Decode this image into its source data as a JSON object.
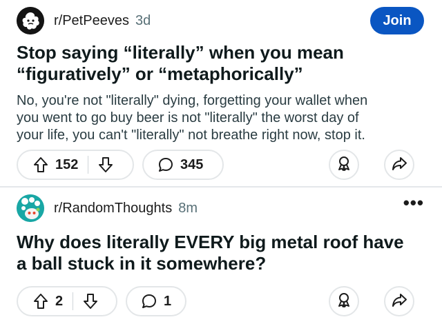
{
  "posts": [
    {
      "subreddit": "r/PetPeeves",
      "time": "3d",
      "join_label": "Join",
      "title_line1": "Stop saying “literally” when you mean",
      "title_line2": "“figuratively” or “metaphorically”",
      "body_line1": "No, you're not \"literally\" dying, forgetting your wallet when",
      "body_line2": "you went to go buy beer is not \"literally\" the worst day of",
      "body_line3": "your life, you can't \"literally\" not breathe right now, stop it.",
      "upvotes": "152",
      "comments": "345"
    },
    {
      "subreddit": "r/RandomThoughts",
      "time": "8m",
      "more_label": "•••",
      "title_line1": "Why does literally EVERY big metal roof have",
      "title_line2": "a ball stuck in it somewhere?",
      "upvotes": "2",
      "comments": "1"
    }
  ],
  "colors": {
    "join_button": "#0a56c2",
    "pill_border": "#e3e6e8",
    "divider": "#e4e7ea",
    "muted_text": "#576f76"
  },
  "icons": [
    "upvote-icon",
    "downvote-icon",
    "comment-icon",
    "award-icon",
    "share-icon",
    "more-icon"
  ]
}
